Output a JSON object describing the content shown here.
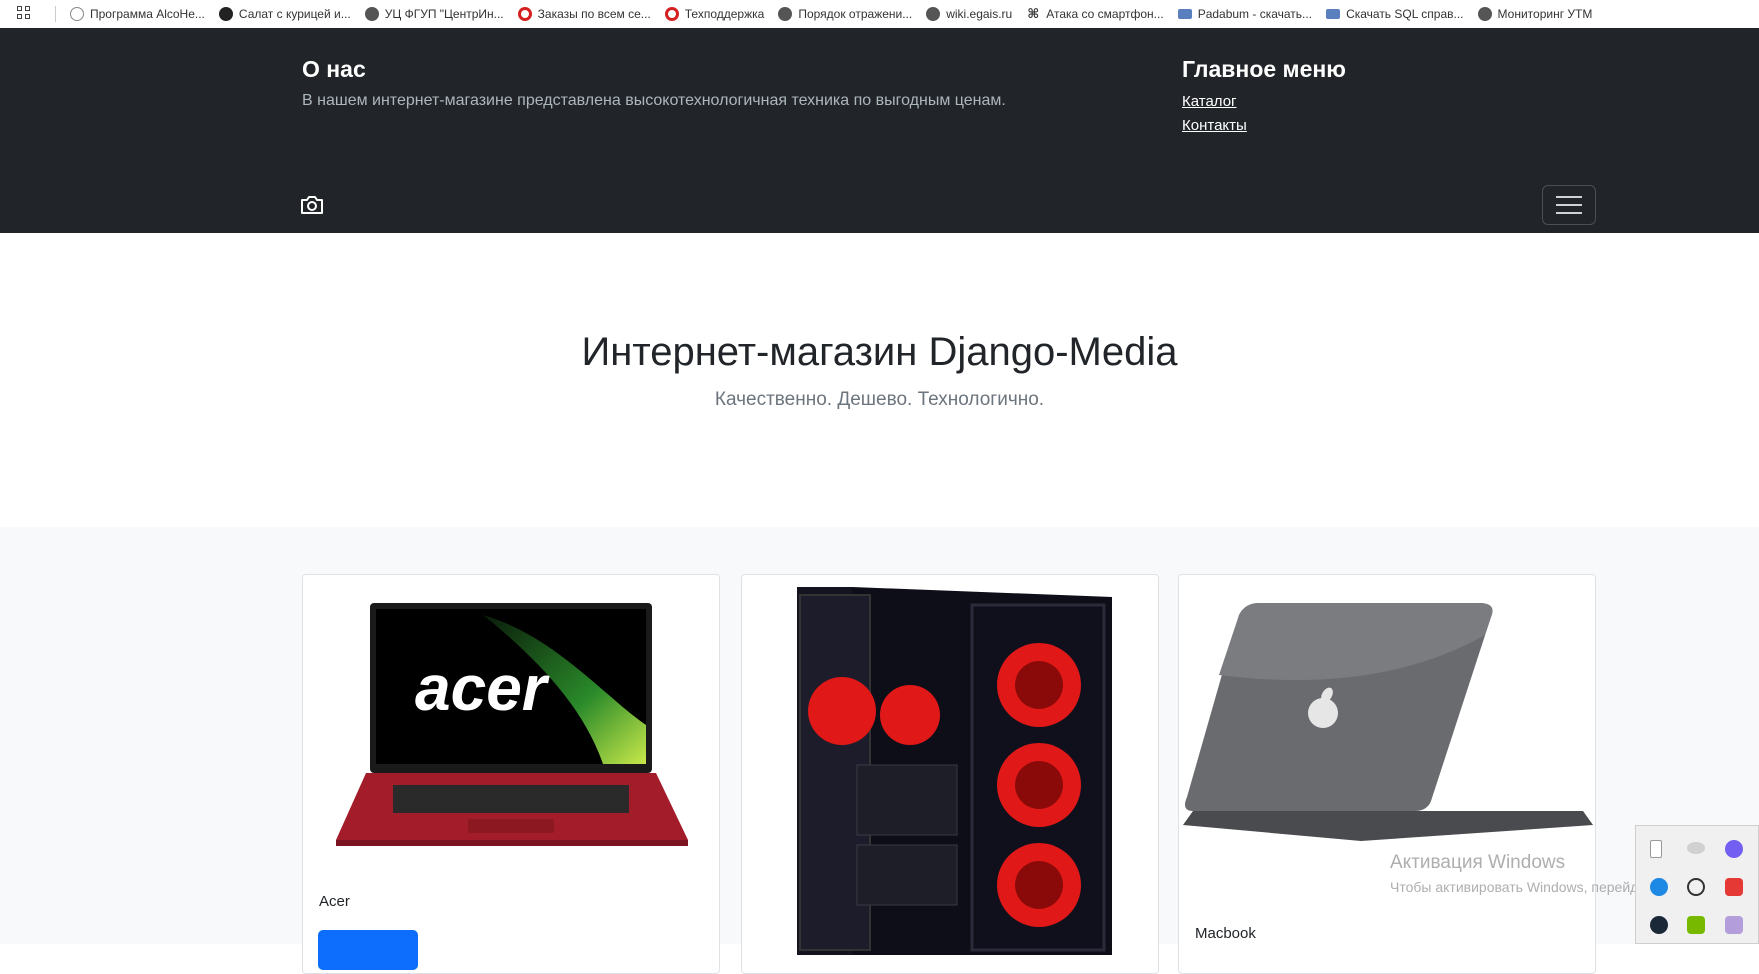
{
  "bookmarks": [
    {
      "label": "Программа AlcoHe...",
      "icon": "cloud-icon",
      "color": "#888888"
    },
    {
      "label": "Салат с курицей и...",
      "icon": "plus-circle-icon",
      "color": "#222222"
    },
    {
      "label": "УЦ ФГУП \"ЦентрИн...",
      "icon": "globe-icon",
      "color": "#555555"
    },
    {
      "label": "Заказы по всем се...",
      "icon": "ring-icon",
      "color": "#d42020"
    },
    {
      "label": "Техподдержка",
      "icon": "ring-icon",
      "color": "#d42020"
    },
    {
      "label": "Порядок отражени...",
      "icon": "globe-icon",
      "color": "#555555"
    },
    {
      "label": "wiki.egais.ru",
      "icon": "globe-icon",
      "color": "#555555"
    },
    {
      "label": "Атака со смартфон...",
      "icon": "hash-icon",
      "color": "#222222"
    },
    {
      "label": "Padabum - скачать...",
      "icon": "book-icon",
      "color": "#5a7fbf"
    },
    {
      "label": "Скачать SQL справ...",
      "icon": "book-icon",
      "color": "#5a7fbf"
    },
    {
      "label": "Мониторинг УТМ",
      "icon": "globe-icon",
      "color": "#555555"
    }
  ],
  "header": {
    "about_title": "О нас",
    "about_text": "В нашем интернет-магазине представлена высокотехнологичная техника по выгодным ценам.",
    "menu_title": "Главное меню",
    "menu_links": [
      "Каталог",
      "Контакты"
    ],
    "logo_icon": "camera-icon",
    "toggler_icon": "hamburger-icon"
  },
  "hero": {
    "title": "Интернет-магазин Django-Media",
    "subtitle": "Качественно. Дешево. Технологично."
  },
  "products": [
    {
      "title": "Acer",
      "image": "acer-laptop-image"
    },
    {
      "title": "",
      "image": "gaming-pc-case-image"
    },
    {
      "title": "Macbook",
      "image": "macbook-laptop-image"
    }
  ],
  "overlay": {
    "activation_title": "Активация Windows",
    "activation_text": "Чтобы активировать Windows, перейдите в раздел \""
  },
  "colors": {
    "header_bg": "#212529",
    "primary": "#0d6efd",
    "album_bg": "#f8f9fa"
  }
}
